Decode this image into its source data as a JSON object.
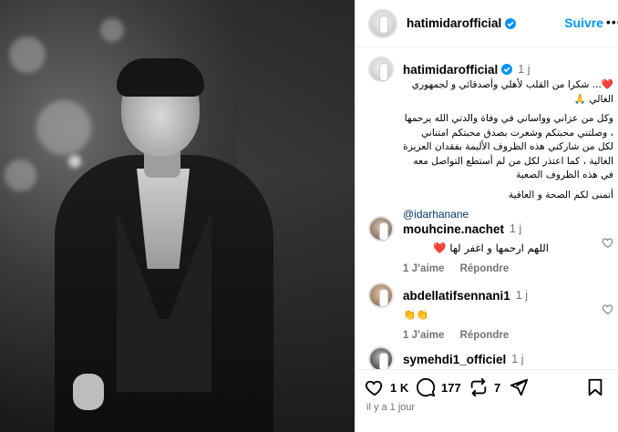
{
  "post": {
    "username": "hatimidarofficial",
    "follow_label": "Suivre",
    "more_label": "•••",
    "caption_time": "1 j",
    "caption_lines": [
      "❤️... شكرا من القلب لأهلي وأصدقائي و لجمهوري الغالي 🙏",
      "وكل من عزاني وواساني في وفاة والدتي الله يرحمها ، وصلتني محبتكم وشعرت بصدق محبتكم امتناني لكل من شاركني هذه الظروف الأليمة بفقدان العزيزة الغالية ، كما اعتذر لكل من لم أستطع التواصل معه في هذه الظروف الصعبة",
      "أتمنى لكم الصحة و العافية"
    ],
    "mention": "@idarhanane"
  },
  "comments": [
    {
      "username": "mouhcine.nachet",
      "time": "1 j",
      "text": "اللهم ارحمها و اغفر لها ❤️",
      "likes": "1 J’aime",
      "reply": "Répondre"
    },
    {
      "username": "abdellatifsennani1",
      "time": "1 j",
      "text": "👏👏",
      "likes": "1 J’aime",
      "reply": "Répondre"
    },
    {
      "username": "symehdi1_officiel",
      "time": "1 j"
    }
  ],
  "actions": {
    "likes": "1 K",
    "comments": "177",
    "reposts": "7"
  },
  "posted_ago": "il y a 1 jour",
  "colors": {
    "link": "#0095f6",
    "mention": "#00376b",
    "muted": "#737373",
    "heart": "#ed4956"
  }
}
